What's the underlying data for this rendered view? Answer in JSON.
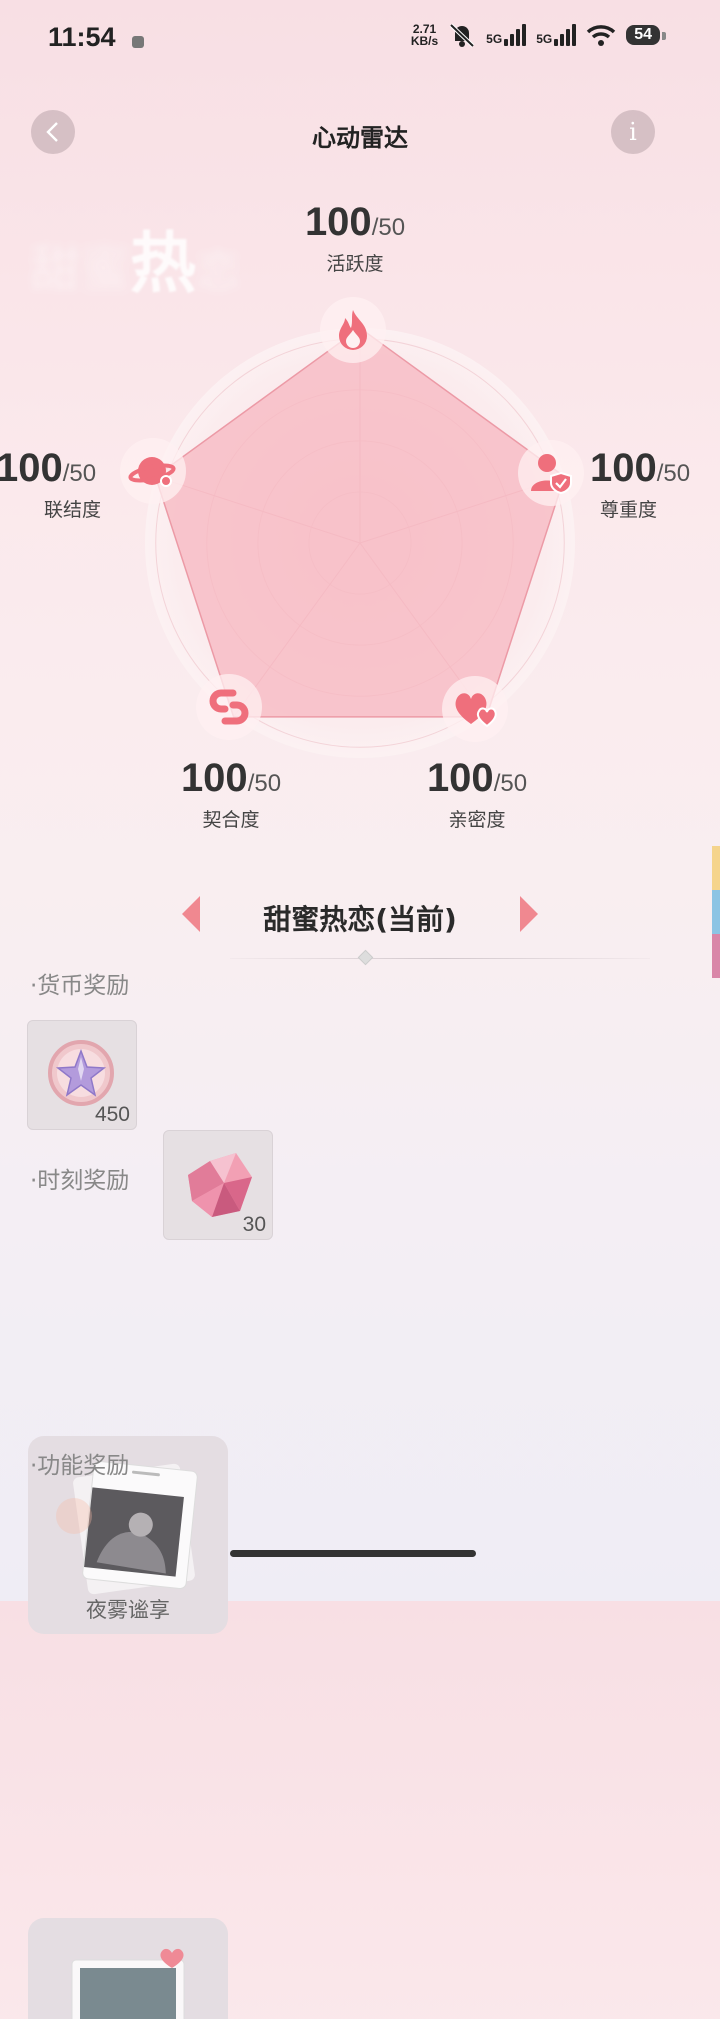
{
  "status_bar": {
    "time": "11:54",
    "net_speed_value": "2.71",
    "net_speed_unit": "KB/s",
    "signal1": "5G",
    "signal2": "5G",
    "battery": "54"
  },
  "header": {
    "title": "心动雷达",
    "back_icon": "chevron-left-icon",
    "info_icon": "info-icon",
    "info_glyph": "i"
  },
  "background_title": [
    "甜",
    "蜜",
    "热",
    "恋"
  ],
  "radar": {
    "stats": [
      {
        "key": "activity",
        "value": "100",
        "max": "/50",
        "label": "活跃度",
        "icon": "flame-icon"
      },
      {
        "key": "respect",
        "value": "100",
        "max": "/50",
        "label": "尊重度",
        "icon": "person-shield-icon"
      },
      {
        "key": "intimacy",
        "value": "100",
        "max": "/50",
        "label": "亲密度",
        "icon": "hearts-icon"
      },
      {
        "key": "fit",
        "value": "100",
        "max": "/50",
        "label": "契合度",
        "icon": "link-icon"
      },
      {
        "key": "connection",
        "value": "100",
        "max": "/50",
        "label": "联结度",
        "icon": "planet-icon"
      }
    ],
    "fill_level": 1.0
  },
  "stage": {
    "title": "甜蜜热恋(当前)"
  },
  "sections": {
    "currency_label": "·货币奖励",
    "moment_label": "·时刻奖励",
    "function_label": "·功能奖励"
  },
  "currency_rewards": [
    {
      "name": "star-coin-icon",
      "count": "450"
    },
    {
      "name": "crystal-icon",
      "count": "30"
    }
  ],
  "moment_rewards": [
    {
      "name": "photo-card",
      "caption": "夜雾谧享"
    }
  ],
  "colors": {
    "accent": "#f08890",
    "radar_fill": "#f7b7c0",
    "icon_color": "#ef6f7c"
  }
}
